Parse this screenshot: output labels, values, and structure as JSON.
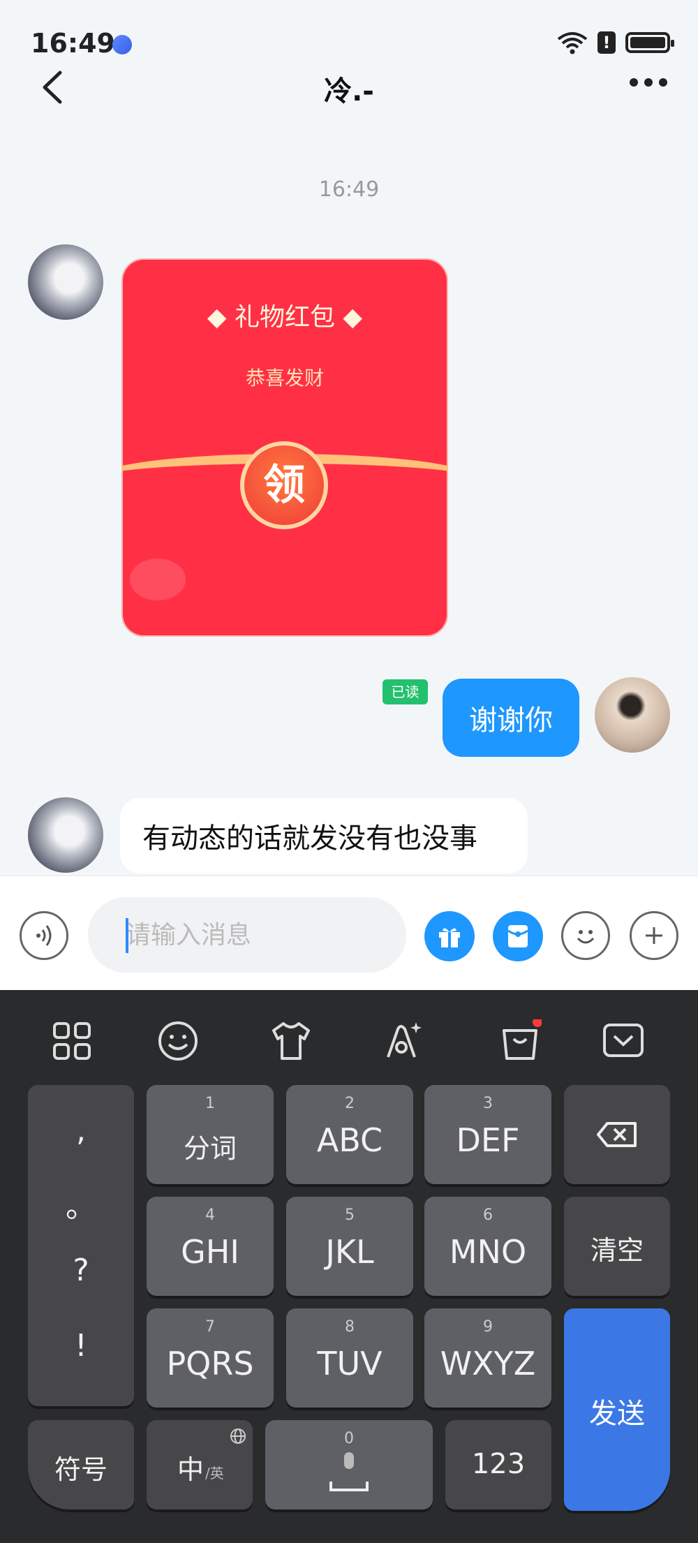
{
  "status": {
    "time": "16:49"
  },
  "header": {
    "title": "冷.-"
  },
  "chat": {
    "timestamp": "16:49",
    "red_packet": {
      "title": "◆ 礼物红包 ◆",
      "subtitle": "恭喜发财",
      "button": "领"
    },
    "read_badge": "已读",
    "my_message": "谢谢你",
    "their_message": "有动态的话就发没有也没事"
  },
  "input": {
    "placeholder": "请输入消息"
  },
  "keyboard": {
    "punct": [
      ",",
      "。",
      "?",
      "!"
    ],
    "keys": [
      {
        "num": "1",
        "label": "分词"
      },
      {
        "num": "2",
        "label": "ABC"
      },
      {
        "num": "3",
        "label": "DEF"
      },
      {
        "num": "4",
        "label": "GHI"
      },
      {
        "num": "5",
        "label": "JKL"
      },
      {
        "num": "6",
        "label": "MNO"
      },
      {
        "num": "7",
        "label": "PQRS"
      },
      {
        "num": "8",
        "label": "TUV"
      },
      {
        "num": "9",
        "label": "WXYZ"
      }
    ],
    "clear": "清空",
    "send": "发送",
    "symbols": "符号",
    "lang": "中",
    "lang_sub": "/英",
    "space_num": "0",
    "numbers": "123"
  },
  "colors": {
    "accent": "#1e97ff",
    "packet": "#ff3046",
    "read_badge": "#23c06e",
    "keyboard": "#2a2b2d",
    "send": "#3b78e6"
  }
}
